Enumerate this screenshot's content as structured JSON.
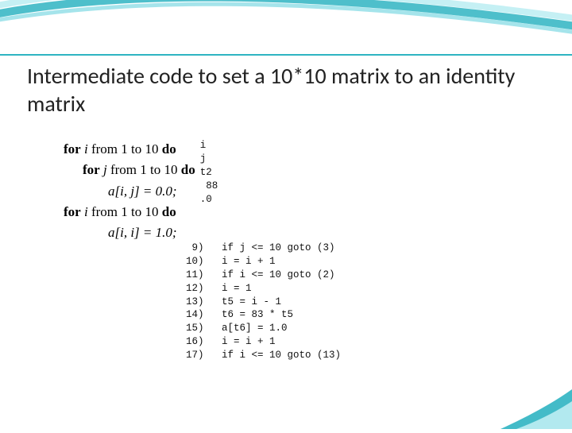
{
  "title": "Intermediate code to set a 10*10 matrix to an identity matrix",
  "source": {
    "line1": {
      "kw1": "for",
      "var": "i",
      "txt1": " from 1 to 10 ",
      "kw2": "do"
    },
    "line2": {
      "kw1": "for",
      "var": "j",
      "txt1": " from 1 to 10 ",
      "kw2": "do"
    },
    "line3": "a[i, j] = 0.0;",
    "line4": {
      "kw1": "for",
      "var": "i",
      "txt1": " from 1 to 10 ",
      "kw2": "do"
    },
    "line5": "a[i, i] = 1.0;"
  },
  "tac_fragments": {
    "f1": "i",
    "f2": "j",
    "f3": "t2",
    "f4": " 88",
    "f5": ".0"
  },
  "tac": [
    " 9)   if j <= 10 goto (3)",
    "10)   i = i + 1",
    "11)   if i <= 10 goto (2)",
    "12)   i = 1",
    "13)   t5 = i - 1",
    "14)   t6 = 83 * t5",
    "15)   a[t6] = 1.0",
    "16)   i = i + 1",
    "17)   if i <= 10 goto (13)"
  ]
}
